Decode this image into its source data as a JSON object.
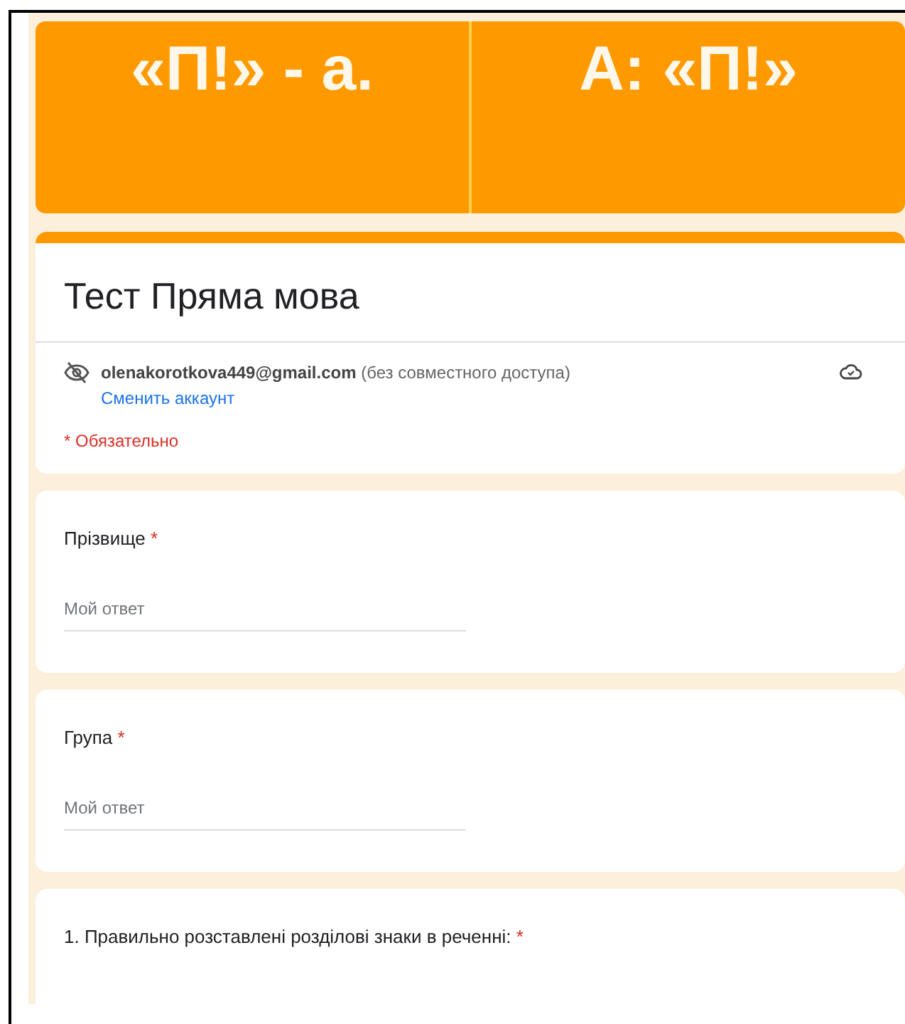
{
  "banner": {
    "cells": [
      "«П!» - а.",
      "А: «П!»"
    ]
  },
  "form": {
    "title": "Тест Пряма мова",
    "account_email": "olenakorotkova449@gmail.com",
    "sharing_note": "(без совместного доступа)",
    "switch_account": "Сменить аккаунт",
    "required_note": "* Обязательно"
  },
  "questions": [
    {
      "label": "Прізвище",
      "required_mark": "*",
      "placeholder": "Мой ответ"
    },
    {
      "label": "Група",
      "required_mark": "*",
      "placeholder": "Мой ответ"
    },
    {
      "label": "1. Правильно розставлені розділові знаки в реченні:",
      "required_mark": "*"
    }
  ]
}
